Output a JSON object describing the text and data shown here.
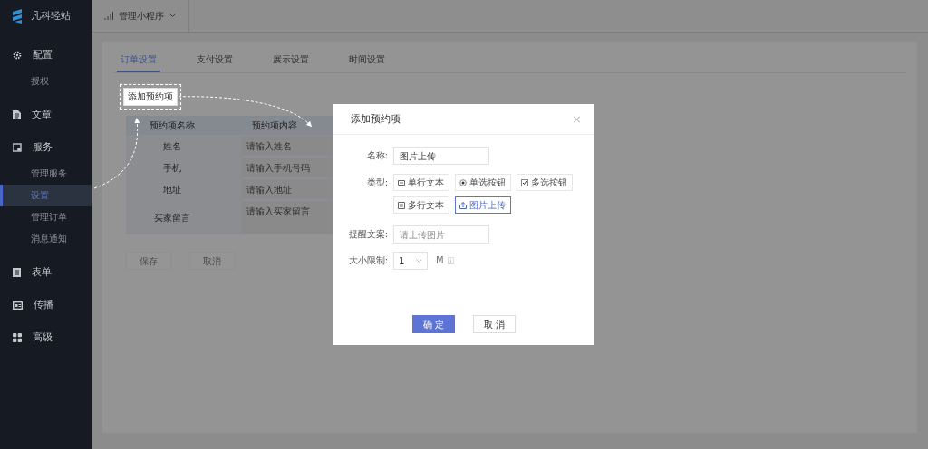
{
  "brand": {
    "name": "凡科轻站"
  },
  "sidebar": {
    "items": [
      {
        "label": "配置",
        "children": [
          {
            "label": "授权",
            "selected": false
          }
        ]
      },
      {
        "label": "文章"
      },
      {
        "label": "服务",
        "children": [
          {
            "label": "管理服务",
            "selected": false
          },
          {
            "label": "设置",
            "selected": true
          },
          {
            "label": "管理订单",
            "selected": false
          },
          {
            "label": "消息通知",
            "selected": false
          }
        ]
      },
      {
        "label": "表单"
      },
      {
        "label": "传播"
      },
      {
        "label": "高级"
      }
    ]
  },
  "topbar": {
    "menu": "管理小程序"
  },
  "tabs": [
    {
      "label": "订单设置",
      "selected": true
    },
    {
      "label": "支付设置",
      "selected": false
    },
    {
      "label": "展示设置",
      "selected": false
    },
    {
      "label": "时间设置",
      "selected": false
    }
  ],
  "add_button": "添加预约项",
  "table": {
    "columns": [
      "预约项名称",
      "预约项内容"
    ],
    "rows": [
      {
        "name": "姓名",
        "placeholder": "请输入姓名",
        "kind": "input"
      },
      {
        "name": "手机",
        "placeholder": "请输入手机号码",
        "kind": "input"
      },
      {
        "name": "地址",
        "placeholder": "请输入地址",
        "kind": "input"
      },
      {
        "name": "买家留言",
        "placeholder": "请输入买家留言",
        "kind": "textarea"
      }
    ]
  },
  "page_buttons": [
    {
      "label": "保存",
      "disabled": true
    },
    {
      "label": "取消",
      "disabled": true
    }
  ],
  "dialog": {
    "title": "添加预约项",
    "close": "×",
    "name_label": "名称:",
    "name_value": "图片上传",
    "type_label": "类型:",
    "types": [
      {
        "label": "单行文本",
        "kind": "single-line",
        "selected": false
      },
      {
        "label": "单选按钮",
        "kind": "radio",
        "selected": false
      },
      {
        "label": "多选按钮",
        "kind": "checkbox",
        "selected": false
      },
      {
        "label": "多行文本",
        "kind": "multi-line",
        "selected": false
      },
      {
        "label": "图片上传",
        "kind": "upload",
        "selected": true
      }
    ],
    "hint_label": "提醒文案:",
    "hint_placeholder": "请上传图片",
    "size_label": "大小限制:",
    "size_value": "1",
    "size_unit": "M",
    "ok": "确 定",
    "cancel": "取 消"
  }
}
